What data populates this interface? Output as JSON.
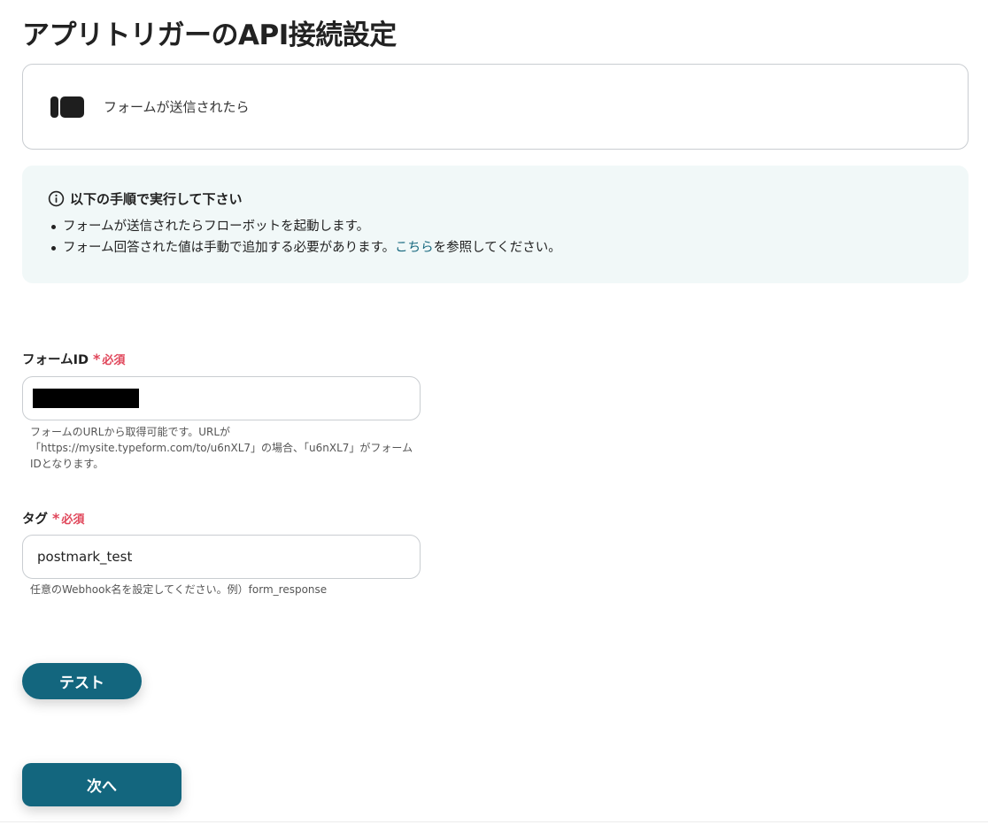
{
  "page": {
    "title": "アプリトリガーのAPI接続設定"
  },
  "trigger_app": {
    "icon": "typeform-logo",
    "label": "フォームが送信されたら"
  },
  "info": {
    "icon": "info-circle-icon",
    "heading": "以下の手順で実行して下さい",
    "item1": "フォームが送信されたらフローボットを起動します。",
    "item2_before": "フォーム回答された値は手動で追加する必要があります。",
    "item2_link": "こちら",
    "item2_after": "を参照してください。"
  },
  "form_id_field": {
    "label": "フォームID",
    "required_mark": "*",
    "required_text": "必須",
    "value": "",
    "help": "フォームのURLから取得可能です。URLが「https://mysite.typeform.com/to/u6nXL7」の場合、「u6nXL7」がフォームIDとなります。"
  },
  "tag_field": {
    "label": "タグ",
    "required_mark": "*",
    "required_text": "必須",
    "value": "postmark_test",
    "help": "任意のWebhook名を設定してください。例）form_response"
  },
  "buttons": {
    "test_label": "テスト",
    "next_label": "次へ"
  },
  "colors": {
    "primary": "#13667e",
    "required": "#e0465a",
    "info_bg": "#f1f8f8",
    "link": "#1a6a80"
  }
}
